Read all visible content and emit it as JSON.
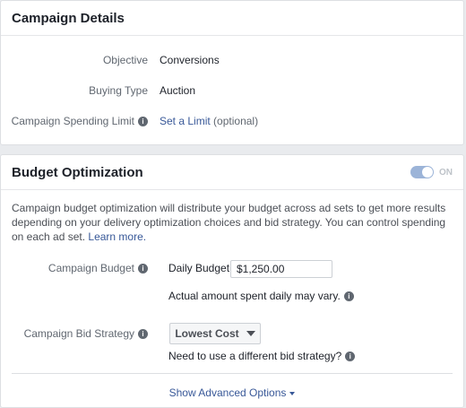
{
  "campaign_details": {
    "title": "Campaign Details",
    "objective_label": "Objective",
    "objective_value": "Conversions",
    "buying_type_label": "Buying Type",
    "buying_type_value": "Auction",
    "spending_limit_label": "Campaign Spending Limit",
    "spending_limit_link": "Set a Limit",
    "spending_limit_optional": "(optional)"
  },
  "budget_optimization": {
    "title": "Budget Optimization",
    "toggle_label": "ON",
    "toggle_on": true,
    "description": "Campaign budget optimization will distribute your budget across ad sets to get more results depending on your delivery optimization choices and bid strategy. You can control spending on each ad set.",
    "learn_more": "Learn more.",
    "budget_label": "Campaign Budget",
    "budget_type": "Daily Budget",
    "budget_value": "$1,250.00",
    "budget_note": "Actual amount spent daily may vary.",
    "bid_strategy_label": "Campaign Bid Strategy",
    "bid_strategy_value": "Lowest Cost",
    "bid_strategy_note": "Need to use a different bid strategy?",
    "advanced_options": "Show Advanced Options"
  },
  "icons": {
    "info": "i"
  },
  "colors": {
    "link": "#385898",
    "toggle": "#9cb4d8"
  }
}
